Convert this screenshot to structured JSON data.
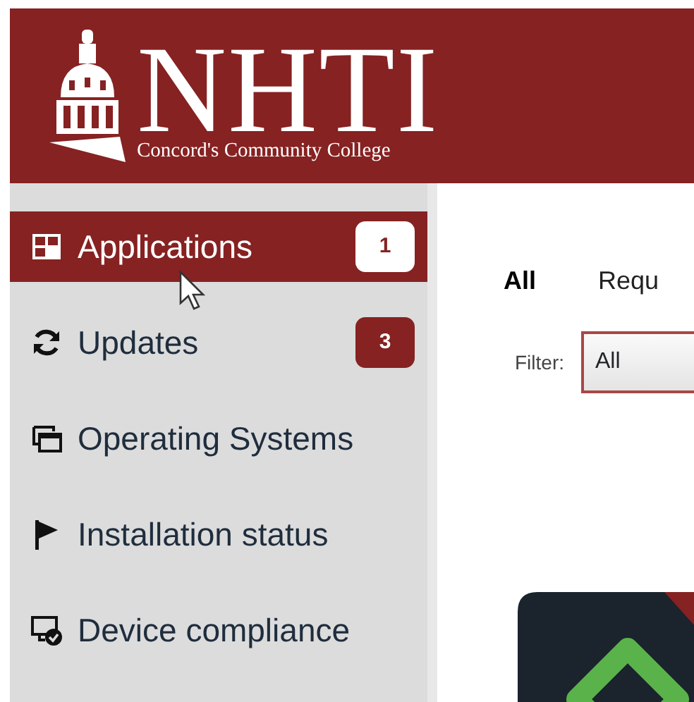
{
  "header": {
    "logo_title": "NHTI",
    "logo_subtitle": "Concord's Community College"
  },
  "sidebar": {
    "items": [
      {
        "label": "Applications",
        "selected": true,
        "badge": "1"
      },
      {
        "label": "Updates",
        "selected": false,
        "badge": "3"
      },
      {
        "label": "Operating Systems",
        "selected": false
      },
      {
        "label": "Installation status",
        "selected": false
      },
      {
        "label": "Device compliance",
        "selected": false
      }
    ]
  },
  "tabs": [
    {
      "label": "All",
      "selected": true
    },
    {
      "label": "Requ",
      "selected": false
    }
  ],
  "filter": {
    "label": "Filter:",
    "value": "All"
  }
}
